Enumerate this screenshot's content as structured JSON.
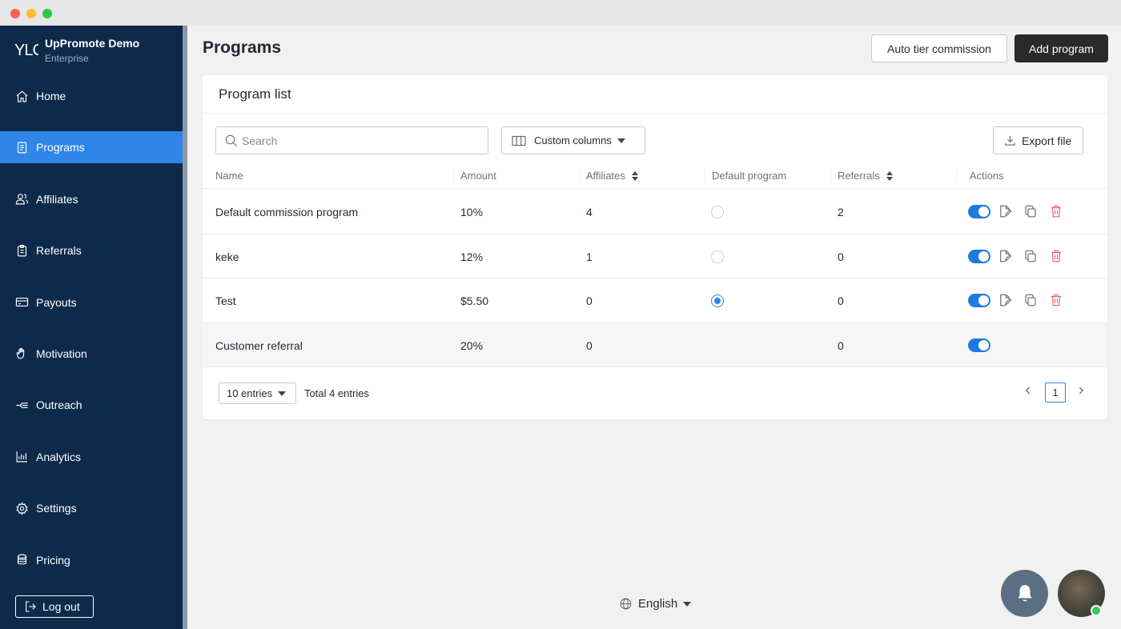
{
  "sidebar": {
    "brand": {
      "logo_text": "YLC",
      "name": "UpPromote Demo",
      "plan": "Enterprise"
    },
    "items": [
      {
        "label": "Home",
        "icon": "home-icon",
        "active": false
      },
      {
        "label": "Programs",
        "icon": "programs-icon",
        "active": true
      },
      {
        "label": "Affiliates",
        "icon": "affiliates-icon",
        "active": false
      },
      {
        "label": "Referrals",
        "icon": "referrals-icon",
        "active": false
      },
      {
        "label": "Payouts",
        "icon": "payouts-icon",
        "active": false
      },
      {
        "label": "Motivation",
        "icon": "motivation-icon",
        "active": false
      },
      {
        "label": "Outreach",
        "icon": "outreach-icon",
        "active": false
      },
      {
        "label": "Analytics",
        "icon": "analytics-icon",
        "active": false
      },
      {
        "label": "Settings",
        "icon": "settings-icon",
        "active": false
      },
      {
        "label": "Pricing",
        "icon": "pricing-icon",
        "active": false
      }
    ],
    "logout_label": "Log out"
  },
  "header": {
    "title": "Programs",
    "auto_tier_label": "Auto tier commission",
    "add_program_label": "Add program"
  },
  "card": {
    "title": "Program list",
    "search_placeholder": "Search",
    "custom_columns_label": "Custom columns",
    "export_label": "Export file",
    "columns": [
      "Name",
      "Amount",
      "Affiliates",
      "Default program",
      "Referrals",
      "Actions"
    ],
    "rows": [
      {
        "name": "Default commission program",
        "amount": "10%",
        "affiliates": "4",
        "default": false,
        "referrals": "2",
        "enabled": true,
        "actions": true
      },
      {
        "name": "keke",
        "amount": "12%",
        "affiliates": "1",
        "default": false,
        "referrals": "0",
        "enabled": true,
        "actions": true
      },
      {
        "name": "Test",
        "amount": "$5.50",
        "affiliates": "0",
        "default": true,
        "referrals": "0",
        "enabled": true,
        "actions": true
      },
      {
        "name": "Customer referral",
        "amount": "20%",
        "affiliates": "0",
        "default": null,
        "referrals": "0",
        "enabled": true,
        "actions": false
      }
    ],
    "page_size_label": "10 entries",
    "total_label": "Total 4 entries",
    "current_page": "1"
  },
  "footer": {
    "language": "English"
  },
  "colors": {
    "sidebar": "#0e2a4b",
    "accent": "#2f86e6",
    "toggle": "#1f7ae0",
    "delete": "#e25c5c"
  }
}
